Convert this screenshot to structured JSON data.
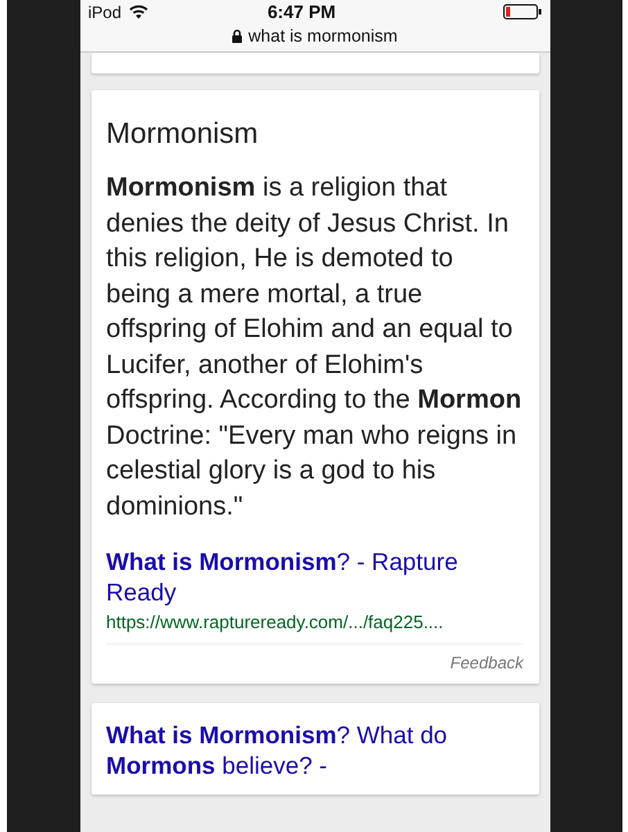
{
  "status_bar": {
    "carrier": "iPod",
    "time": "6:47 PM"
  },
  "address_bar": {
    "text": "what is mormonism"
  },
  "answer_card": {
    "title": "Mormonism",
    "text": "**Mormonism** is a religion that denies the deity of Jesus Christ. In this religion, He is demoted to being a mere mortal, a true offspring of Elohim and an equal to Lucifer, another of Elohim's offspring. According to the **Mormon** Doctrine: \"Every man who reigns in celestial glory is a god to his dominions.\"",
    "source_title": "**What is Mormonism**? - Rapture Ready",
    "source_url": "https://www.raptureready.com/.../faq225....",
    "feedback": "Feedback"
  },
  "next_result": {
    "title": "**What is Mormonism**? What do **Mormons** believe? -"
  }
}
